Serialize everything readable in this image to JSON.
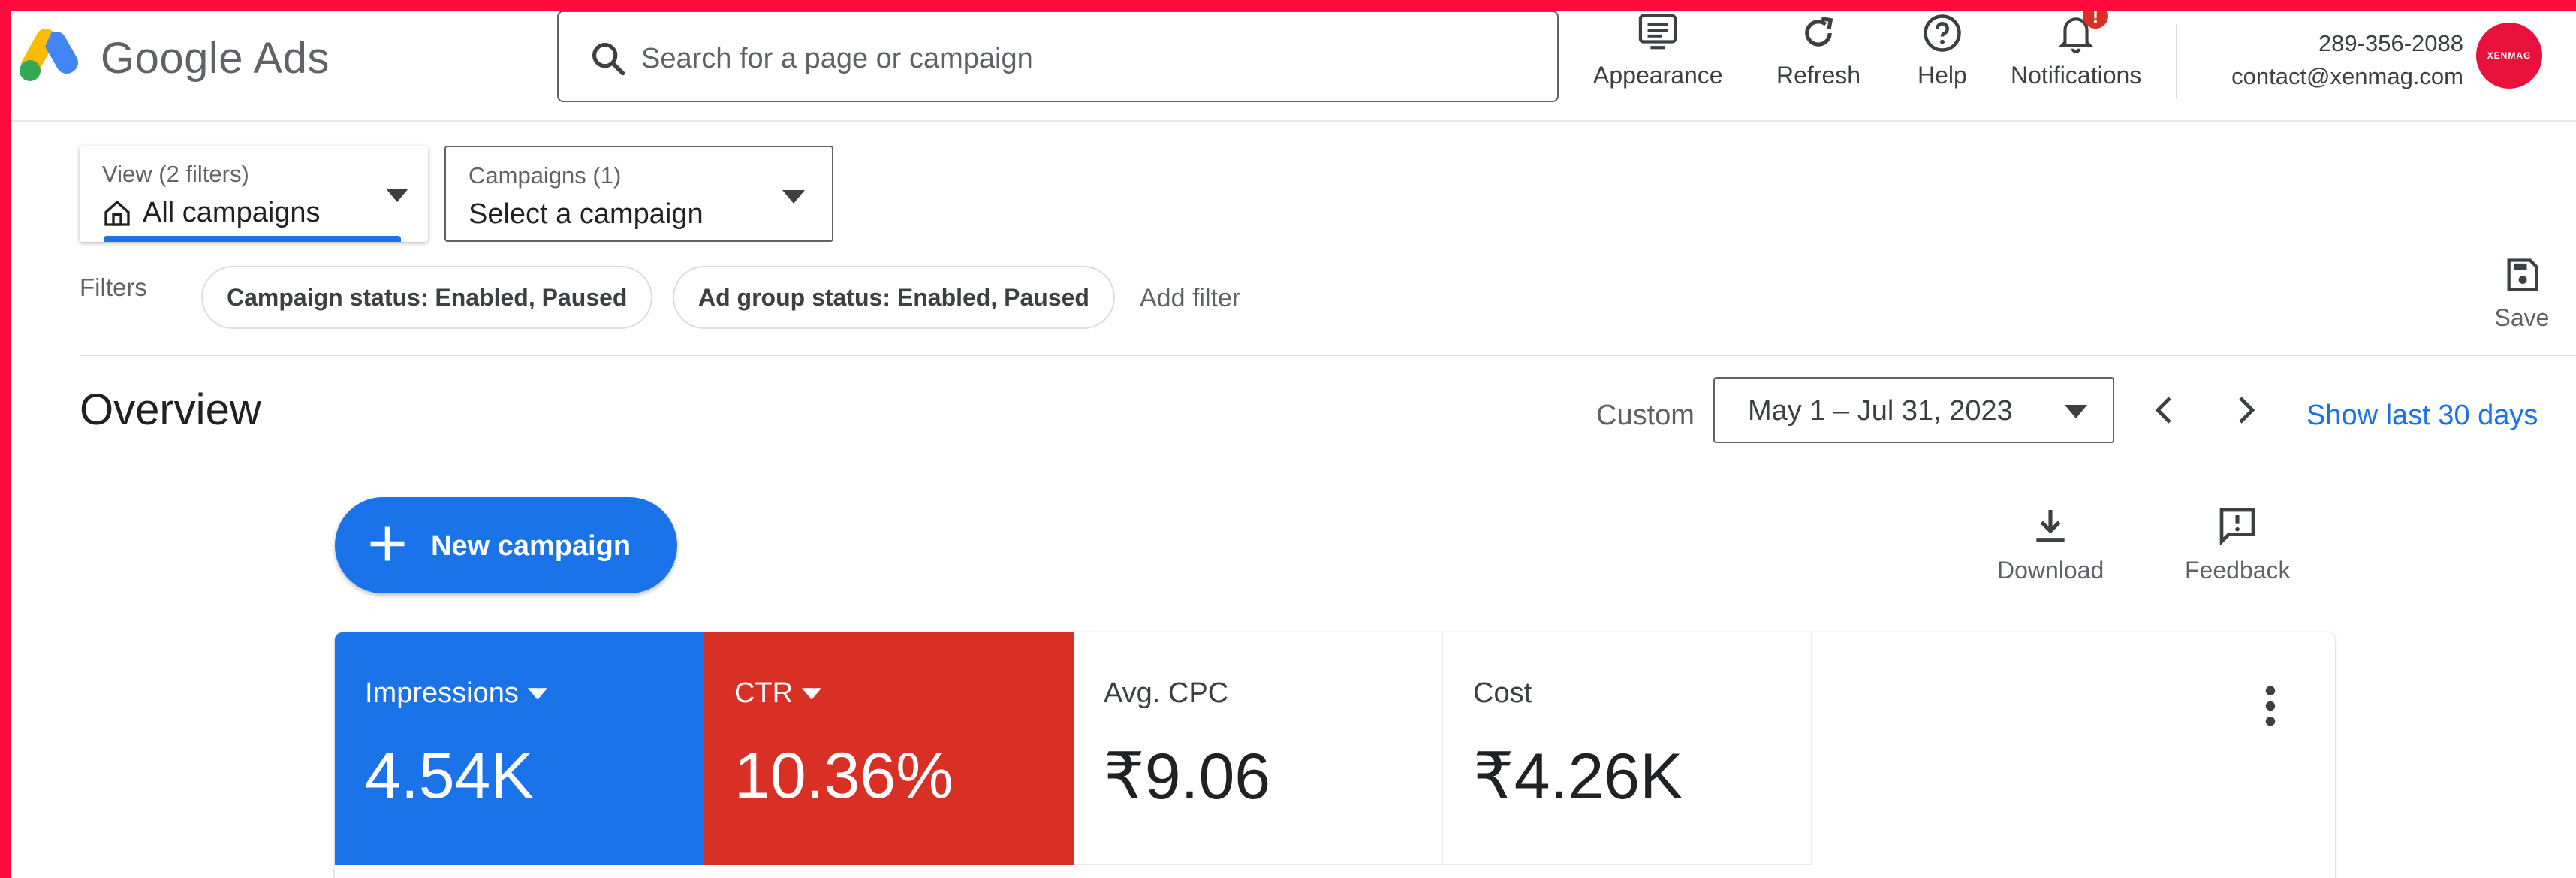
{
  "header": {
    "brand": "Google Ads",
    "search_placeholder": "Search for a page or campaign",
    "tools": {
      "appearance": "Appearance",
      "refresh": "Refresh",
      "help": "Help",
      "notifications": "Notifications",
      "notifications_badge": "!"
    },
    "account": {
      "phone": "289-356-2088",
      "email": "contact@xenmag.com",
      "avatar_text": "XENMAG"
    }
  },
  "selectors": {
    "view": {
      "label": "View (2 filters)",
      "value": "All campaigns"
    },
    "campaigns": {
      "label": "Campaigns (1)",
      "value": "Select a campaign"
    }
  },
  "filters": {
    "label": "Filters",
    "chips": [
      "Campaign status: Enabled, Paused",
      "Ad group status: Enabled, Paused"
    ],
    "add_filter": "Add filter",
    "save": "Save"
  },
  "overview": {
    "title": "Overview",
    "range_type": "Custom",
    "date_range": "May 1 – Jul 31, 2023",
    "show_last": "Show last 30 days"
  },
  "actions": {
    "new_campaign": "New campaign",
    "download": "Download",
    "feedback": "Feedback"
  },
  "metrics": [
    {
      "name": "Impressions",
      "value": "4.54K",
      "color": "#1a73e8"
    },
    {
      "name": "CTR",
      "value": "10.36%",
      "color": "#d93025"
    },
    {
      "name": "Avg. CPC",
      "value": "₹9.06"
    },
    {
      "name": "Cost",
      "value": "₹4.26K"
    }
  ],
  "colors": {
    "frame_border": "#ff0a3c",
    "accent_blue": "#1a73e8",
    "accent_red": "#d93025"
  }
}
